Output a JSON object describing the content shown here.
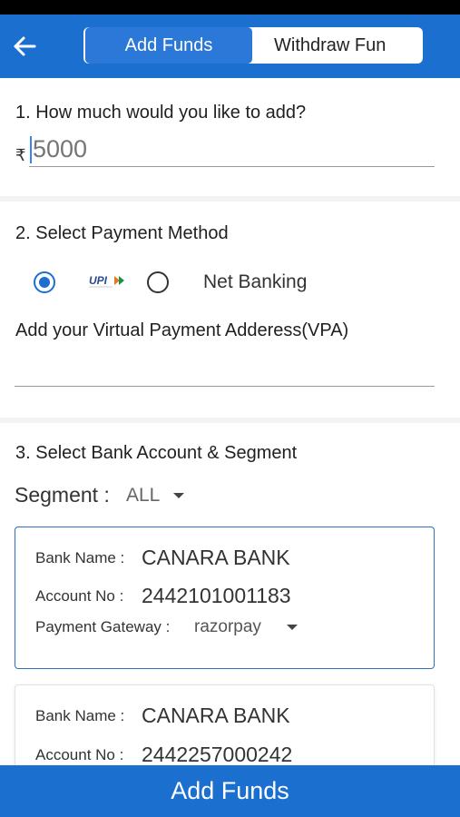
{
  "tabs": {
    "add_funds": "Add Funds",
    "withdraw_funds": "Withdraw Fun"
  },
  "amount": {
    "heading": "1. How much would you like to add?",
    "currency_symbol": "₹",
    "placeholder": "5000"
  },
  "payment": {
    "heading": "2. Select Payment Method",
    "methods": [
      {
        "label": "UPI",
        "icon": "upi-logo",
        "selected": true
      },
      {
        "label": "Net Banking",
        "selected": false
      }
    ],
    "vpa_heading": "Add your Virtual Payment Adderess(VPA)"
  },
  "bank": {
    "heading": "3. Select Bank Account & Segment",
    "segment_label": "Segment :",
    "segment_value": "ALL",
    "accounts": [
      {
        "bank_name_label": "Bank Name :",
        "bank_name": "CANARA BANK",
        "account_no_label": "Account No :",
        "account_no": "2442101001183",
        "gateway_label": "Payment Gateway :",
        "gateway": "razorpay",
        "selected": true
      },
      {
        "bank_name_label": "Bank Name :",
        "bank_name": "CANARA BANK",
        "account_no_label": "Account No :",
        "account_no": "2442257000242",
        "selected": false
      }
    ]
  },
  "footer": {
    "button_label": "Add Funds"
  },
  "colors": {
    "primary": "#1b6fcf",
    "tab_active": "#2b78d8",
    "card_border_selected": "#2f6fbf",
    "upi_logo_text": "#2a4a8f",
    "upi_logo_accent": "#e87722"
  }
}
